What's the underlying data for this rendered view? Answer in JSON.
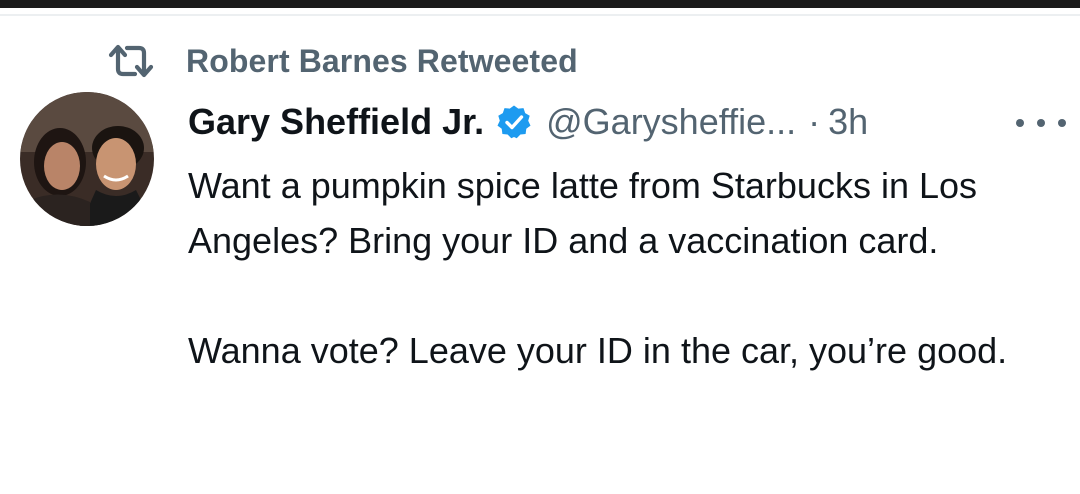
{
  "retweet": {
    "label": "Robert Barnes Retweeted",
    "icon": "retweet-icon"
  },
  "tweet": {
    "avatar_icon": "user-avatar",
    "display_name": "Gary Sheffield Jr.",
    "verified_icon": "verified-badge-icon",
    "handle": "@Garysheffie...",
    "separator": "·",
    "time": "3h",
    "more_icon": "more-options-icon",
    "paragraphs": [
      "Want a pumpkin spice latte from Starbucks in Los Angeles? Bring your ID and a vaccination card.",
      "Wanna vote? Leave your ID in the car, you’re good."
    ]
  },
  "colors": {
    "text_primary": "#0f1419",
    "text_secondary": "#536471",
    "verified": "#1d9bf0",
    "top_bar": "#1b1b1b"
  }
}
